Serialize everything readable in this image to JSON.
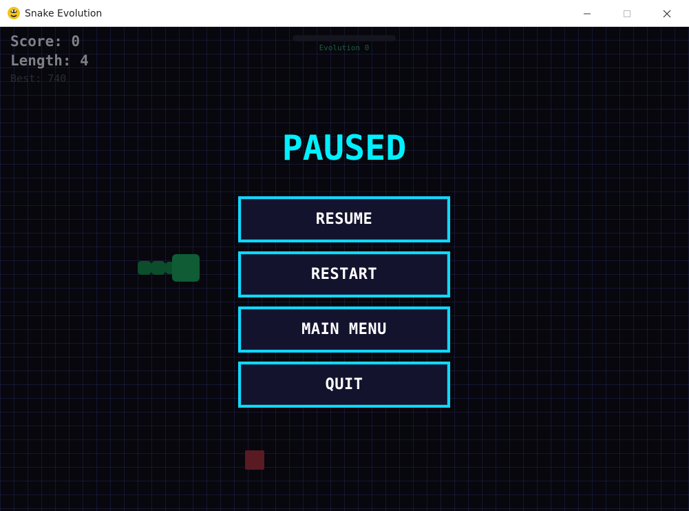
{
  "window": {
    "title": "Snake Evolution",
    "icon": "python-snake-icon"
  },
  "hud": {
    "score": "Score: 0",
    "length": "Length: 4",
    "best": "Best: 740",
    "evolution": "Evolution 0"
  },
  "pause_menu": {
    "title": "PAUSED",
    "buttons": [
      "RESUME",
      "RESTART",
      "MAIN MENU",
      "QUIT"
    ]
  },
  "colors": {
    "background": "#07070d",
    "accent": "#00f0ff",
    "button_border": "#10d8ff",
    "button_fill": "#13132d",
    "snake": "#0f5c35",
    "food": "#5a1a22"
  }
}
